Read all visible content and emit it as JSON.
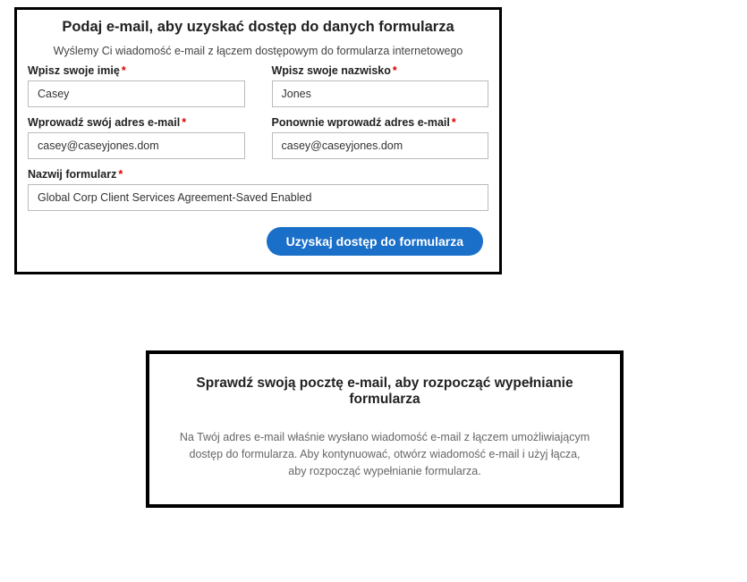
{
  "panel1": {
    "title": "Podaj e-mail, aby uzyskać dostęp do danych formularza",
    "subtitle": "Wyślemy Ci wiadomość e-mail z łączem dostępowym do formularza internetowego",
    "fields": {
      "first_name": {
        "label": "Wpisz swoje imię",
        "required": "*",
        "value": "Casey"
      },
      "last_name": {
        "label": "Wpisz swoje nazwisko",
        "required": "*",
        "value": "Jones"
      },
      "email": {
        "label": "Wprowadź swój adres e-mail",
        "required": "*",
        "value": "casey@caseyjones.dom"
      },
      "email_confirm": {
        "label": "Ponownie wprowadź adres e-mail",
        "required": "*",
        "value": "casey@caseyjones.dom"
      },
      "form_name": {
        "label": "Nazwij formularz",
        "required": "*",
        "value": "Global Corp Client Services Agreement-Saved Enabled"
      }
    },
    "submit_label": "Uzyskaj dostęp do formularza"
  },
  "panel2": {
    "title": "Sprawdź swoją pocztę e-mail, aby rozpocząć wypełnianie formularza",
    "body": "Na Twój adres e-mail właśnie wysłano wiadomość e-mail z łączem umożliwiającym dostęp do formularza. Aby kontynuować, otwórz wiadomość e-mail i użyj łącza, aby rozpocząć wypełnianie formularza."
  }
}
